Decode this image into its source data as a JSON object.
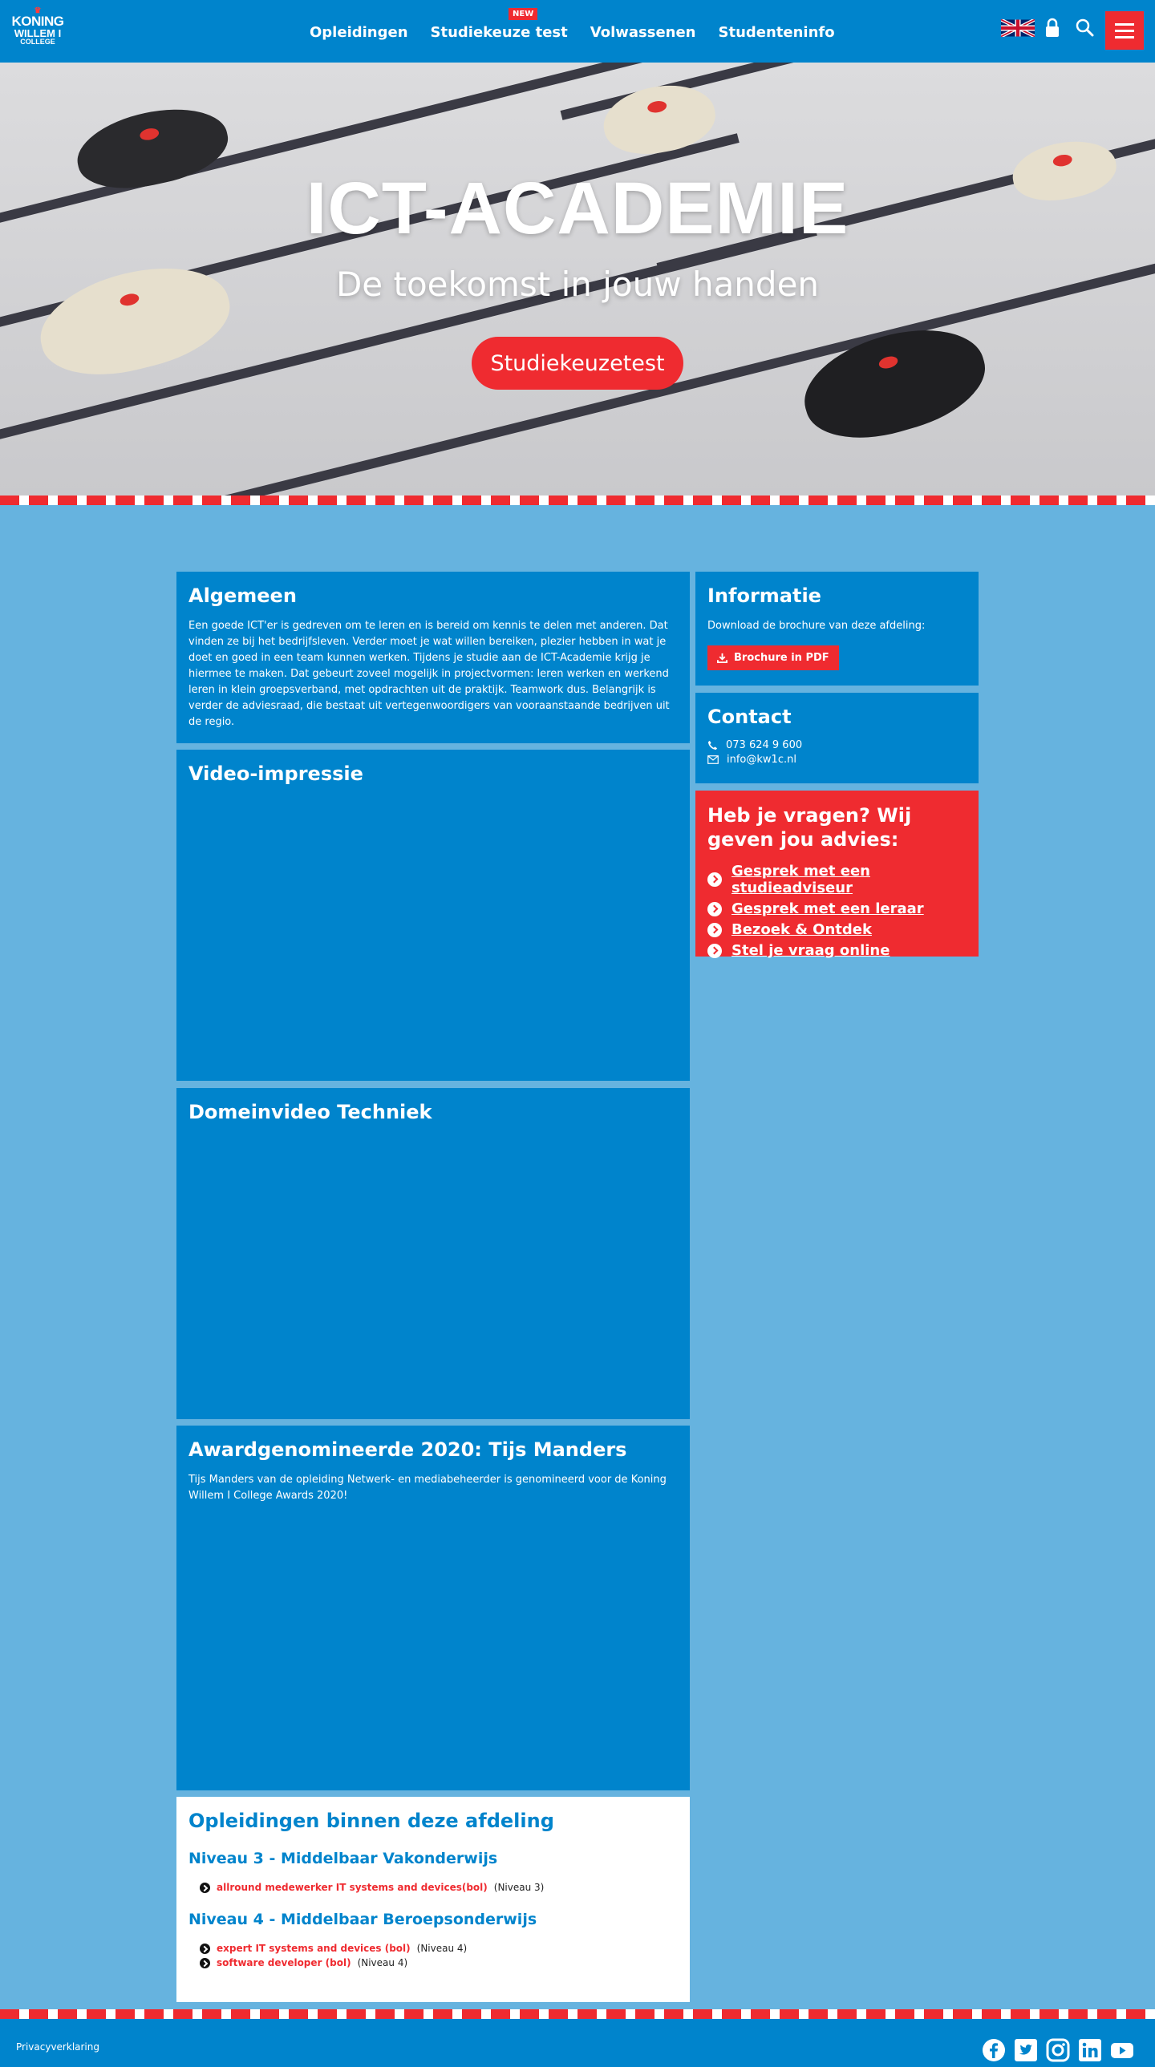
{
  "header": {
    "logo": {
      "line1": "KONING",
      "line2": "WILLEM I",
      "line3": "COLLEGE"
    },
    "nav": [
      "Opleidingen",
      "Studiekeuze test",
      "Volwassenen",
      "Studenteninfo"
    ],
    "new_badge": "NEW",
    "icons": [
      "uk-flag-icon",
      "lock-icon",
      "search-icon",
      "hamburger-menu-icon"
    ],
    "accent_color": "#0084cc",
    "brand_red": "#ef2b30"
  },
  "hero": {
    "title": "ICT-ACADEMIE",
    "subtitle": "De toekomst in jouw handen",
    "cta": "Studiekeuzetest"
  },
  "algemeen": {
    "title": "Algemeen",
    "text": "Een goede ICT'er is gedreven om te leren en is bereid om kennis te delen met anderen. Dat vinden ze bij het bedrijfsleven. Verder moet je wat willen bereiken, plezier hebben in wat je doet en goed in een team kunnen werken. Tijdens je studie aan de ICT-Academie krijg je hiermee te maken. Dat gebeurt zoveel mogelijk in projectvormen: leren werken en werkend leren in klein groepsverband, met opdrachten uit de praktijk. Teamwork dus. Belangrijk is verder de adviesraad, die bestaat uit vertegenwoordigers van vooraanstaande bedrijven uit de regio."
  },
  "video_impressie": {
    "title": "Video-impressie"
  },
  "domeinvideo": {
    "title": "Domeinvideo Techniek"
  },
  "award": {
    "title": "Awardgenomineerde 2020: Tijs Manders",
    "text": "Tijs Manders van de opleiding Netwerk- en mediabeheerder is genomineerd voor de Koning Willem I College Awards 2020!"
  },
  "opleidingen": {
    "title": "Opleidingen binnen deze afdeling",
    "groups": [
      {
        "heading": "Niveau 3 - Middelbaar Vakonderwijs",
        "items": [
          {
            "name": "allround medewerker IT systems and devices(bol)",
            "level": "(Niveau 3)"
          }
        ]
      },
      {
        "heading": "Niveau 4 - Middelbaar Beroepsonderwijs",
        "items": [
          {
            "name": "expert IT systems and devices (bol)",
            "level": "(Niveau 4)"
          },
          {
            "name": "software developer (bol)",
            "level": "(Niveau 4)"
          }
        ]
      }
    ]
  },
  "informatie": {
    "title": "Informatie",
    "text": "Download de brochure van deze afdeling:",
    "button": "Brochure in PDF"
  },
  "contact": {
    "title": "Contact",
    "phone": "073 624 9 600",
    "email": "info@kw1c.nl"
  },
  "vragen": {
    "title": "Heb je vragen? Wij geven jou advies:",
    "links": [
      "Gesprek met een studieadviseur",
      "Gesprek met een leraar",
      "Bezoek & Ontdek",
      "Stel je vraag online"
    ]
  },
  "footer": {
    "privacy": "Privacyverklaring",
    "social": [
      "facebook-icon",
      "twitter-icon",
      "instagram-icon",
      "linkedin-icon",
      "youtube-icon"
    ]
  }
}
